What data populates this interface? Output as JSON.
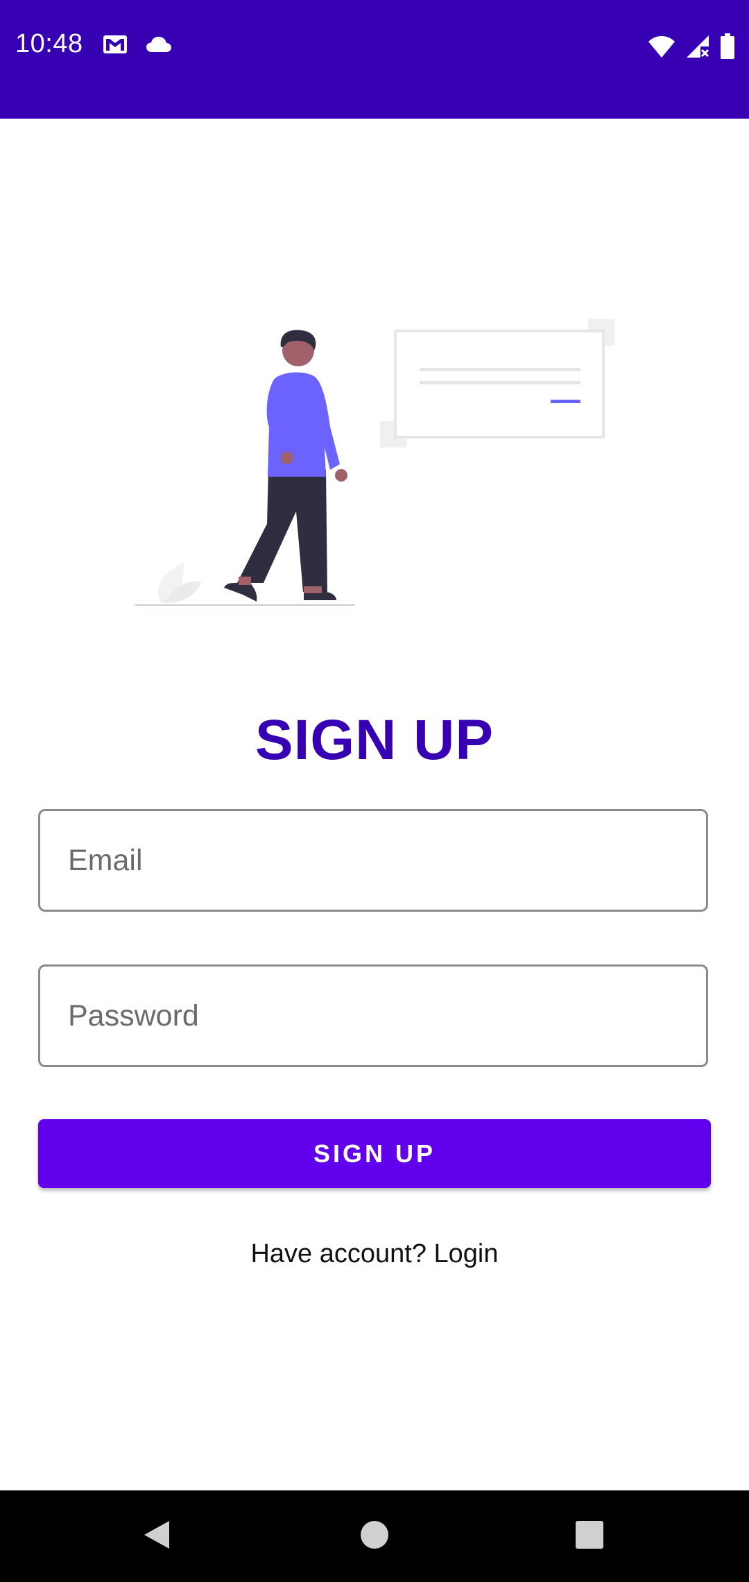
{
  "status_bar": {
    "time": "10:48",
    "background": "#3700b3",
    "left_icons": [
      "gmail-icon",
      "cloud-icon"
    ],
    "right_icons": [
      "wifi-icon",
      "cell-signal-icon",
      "battery-icon"
    ]
  },
  "illustration": {
    "description_icon": "person-walking-by-card-illustration",
    "accent_color": "#6c63ff"
  },
  "main": {
    "title": "SIGN UP",
    "title_color": "#3700b3",
    "email": {
      "placeholder": "Email",
      "value": ""
    },
    "password": {
      "placeholder": "Password",
      "value": ""
    },
    "signup_button_label": "SIGN UP",
    "button_color": "#6200ee",
    "login_prompt": "Have account?",
    "login_link": "Login"
  },
  "nav_bar": {
    "icons": [
      "back-icon",
      "home-icon",
      "recents-icon"
    ]
  }
}
